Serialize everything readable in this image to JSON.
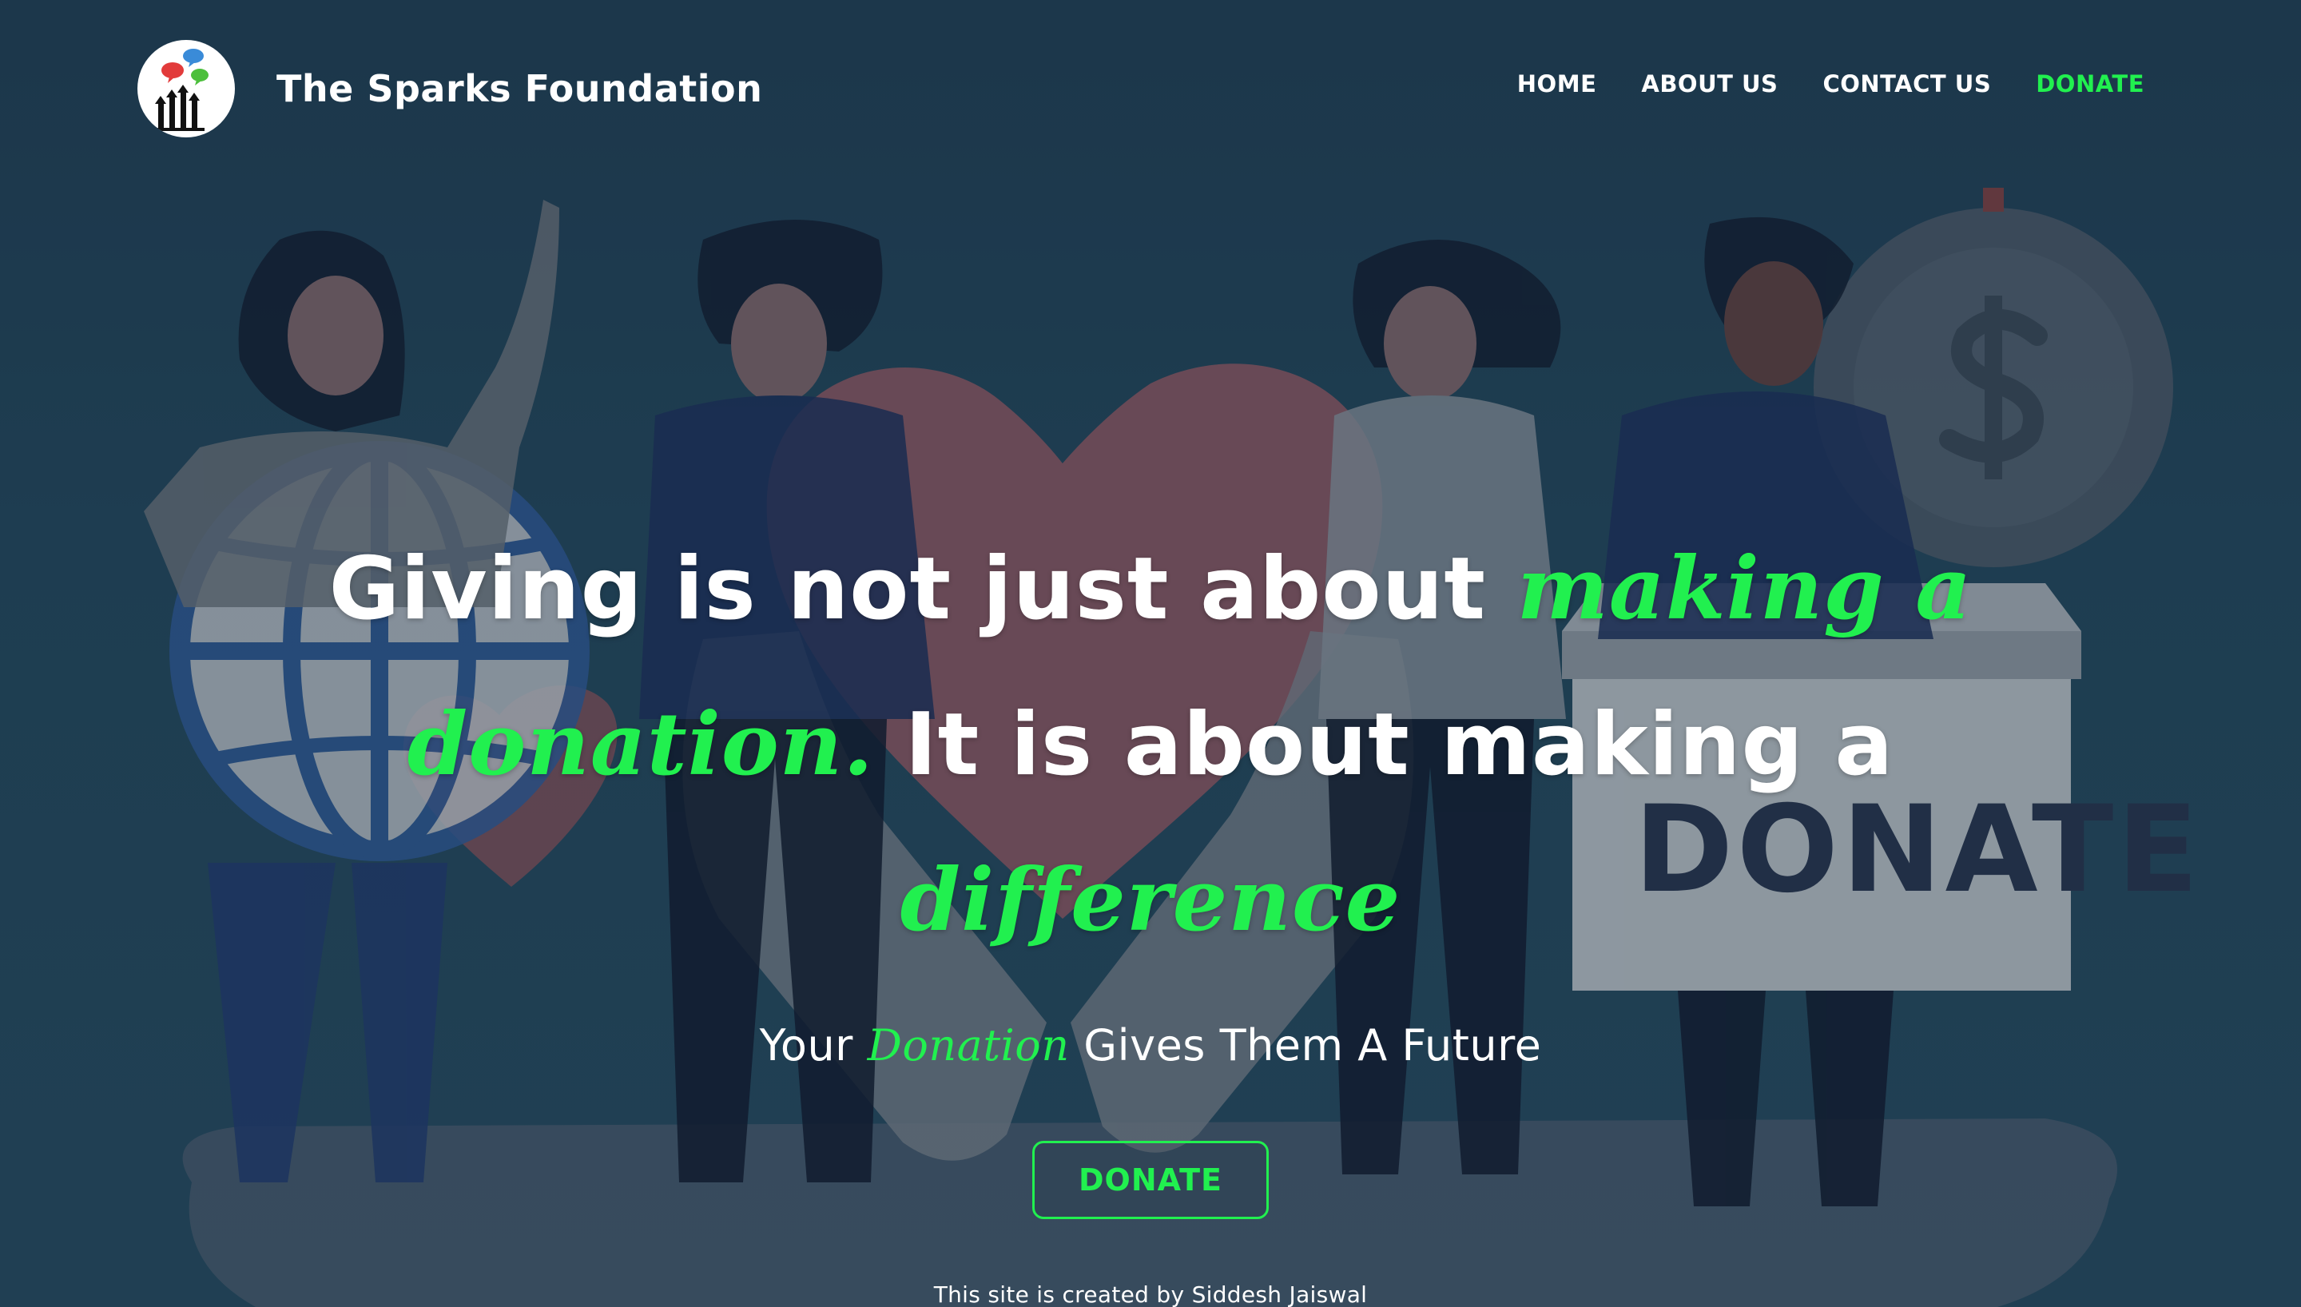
{
  "brand": {
    "name": "The Sparks Foundation",
    "logo_icon": "hands-speech-bubbles-logo"
  },
  "nav": {
    "items": [
      {
        "label": "HOME",
        "active": false
      },
      {
        "label": "ABOUT US",
        "active": false
      },
      {
        "label": "CONTACT US",
        "active": false
      },
      {
        "label": "DONATE",
        "active": true
      }
    ]
  },
  "hero": {
    "headline_part1": "Giving is not just about ",
    "headline_accent1": "making a donation.",
    "headline_part2": " It is about making a ",
    "headline_accent2": "difference",
    "sub_part1": "Your ",
    "sub_accent": "Donation",
    "sub_part2": " Gives Them A Future",
    "donate_button": "DONATE",
    "credit": "This site is created by Siddesh Jaiswal"
  },
  "colors": {
    "accent": "#21f04f",
    "background": "#1f3d52",
    "text": "#ffffff"
  }
}
